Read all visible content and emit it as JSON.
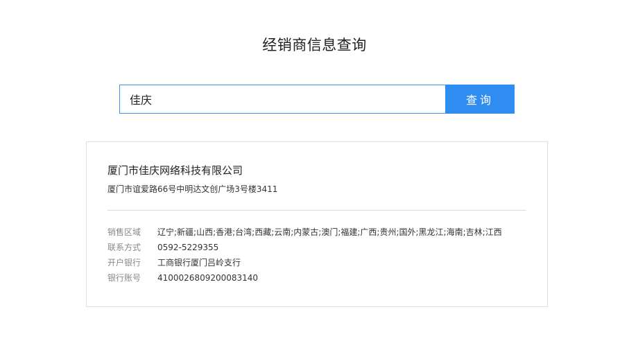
{
  "header": {
    "title": "经销商信息查询"
  },
  "search": {
    "value": "佳庆",
    "button_label": "查询"
  },
  "result": {
    "company_name": "厦门市佳庆网络科技有限公司",
    "address": "厦门市谊爱路66号中明达文创广场3号楼3411",
    "details": [
      {
        "label": "销售区域",
        "value": "辽宁;新疆;山西;香港;台湾;西藏;云南;内蒙古;澳门;福建;广西;贵州;国外;黑龙江;海南;吉林;江西"
      },
      {
        "label": "联系方式",
        "value": "0592-5229355"
      },
      {
        "label": "开户银行",
        "value": "工商银行厦门吕岭支行"
      },
      {
        "label": "银行账号",
        "value": "4100026809200083140"
      }
    ]
  }
}
